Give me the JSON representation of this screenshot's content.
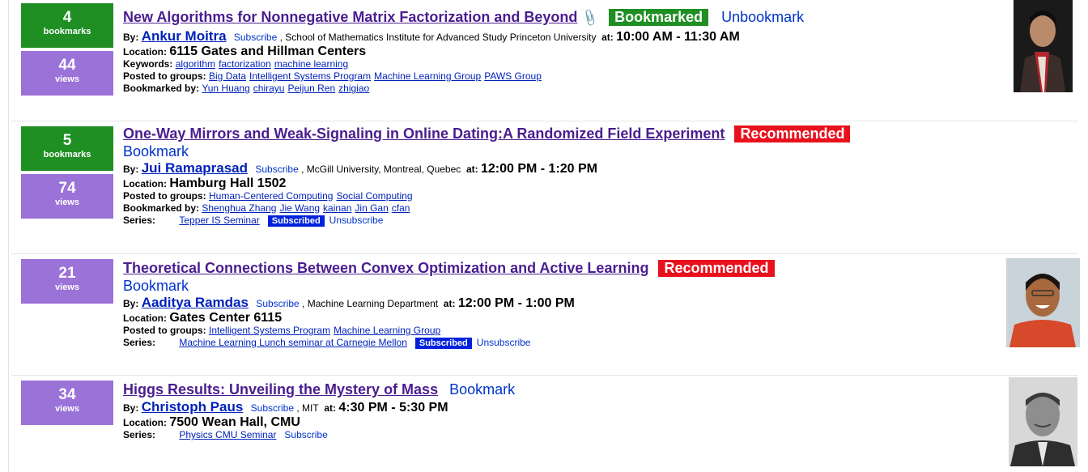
{
  "talks": [
    {
      "bookmarks": "4",
      "bookmarks_label": "bookmarks",
      "views": "44",
      "views_label": "views",
      "title": "New Algorithms for Nonnegative Matrix Factorization and Beyond",
      "status_badge": "Bookmarked",
      "action": "Unbookmark",
      "by_label": "By:",
      "speaker": "Ankur Moitra",
      "subscribe": "Subscribe",
      "affiliation": ", School of Mathematics Institute for Advanced Study Princeton University",
      "at_label": "at:",
      "time": "10:00 AM - 11:30 AM",
      "location_label": "Location:",
      "location": "6115 Gates and Hillman Centers",
      "keywords_label": "Keywords:",
      "keywords": [
        "algorithm",
        "factorization",
        "machine learning"
      ],
      "groups_label": "Posted to groups:",
      "groups": [
        "Big Data",
        "Intelligent Systems Program",
        "Machine Learning Group",
        "PAWS Group"
      ],
      "bookmarked_by_label": "Bookmarked by:",
      "bookmarked_by": [
        "Yun Huang",
        "chirayu",
        "Peijun Ren",
        "zhigiao"
      ]
    },
    {
      "bookmarks": "5",
      "bookmarks_label": "bookmarks",
      "views": "74",
      "views_label": "views",
      "title": "One-Way Mirrors and Weak-Signaling in Online Dating:A Randomized Field Experiment",
      "status_badge": "Recommended",
      "action": "Bookmark",
      "by_label": "By:",
      "speaker": "Jui Ramaprasad",
      "subscribe": "Subscribe",
      "affiliation": ", McGill University, Montreal, Quebec",
      "at_label": "at:",
      "time": "12:00 PM - 1:20 PM",
      "location_label": "Location:",
      "location": "Hamburg Hall 1502",
      "groups_label": "Posted to groups:",
      "groups": [
        "Human-Centered Computing",
        "Social Computing"
      ],
      "bookmarked_by_label": "Bookmarked by:",
      "bookmarked_by": [
        "Shenghua Zhang",
        "Jie Wang",
        "kainan",
        "Jin Gan",
        "cfan"
      ],
      "series_label": "Series:",
      "series": "Tepper IS Seminar",
      "series_status": "Subscribed",
      "series_action": "Unsubscribe"
    },
    {
      "views": "21",
      "views_label": "views",
      "title": "Theoretical Connections Between Convex Optimization and Active Learning",
      "status_badge": "Recommended",
      "action": "Bookmark",
      "by_label": "By:",
      "speaker": "Aaditya Ramdas",
      "subscribe": "Subscribe",
      "affiliation": ", Machine Learning Department",
      "at_label": "at:",
      "time": "12:00 PM - 1:00 PM",
      "location_label": "Location:",
      "location": "Gates Center 6115",
      "groups_label": "Posted to groups:",
      "groups": [
        "Intelligent Systems Program",
        "Machine Learning Group"
      ],
      "series_label": "Series:",
      "series": "Machine Learning Lunch seminar at Carnegie Mellon",
      "series_status": "Subscribed",
      "series_action": "Unsubscribe"
    },
    {
      "views": "34",
      "views_label": "views",
      "title": "Higgs Results: Unveiling the Mystery of Mass",
      "action": "Bookmark",
      "by_label": "By:",
      "speaker": "Christoph Paus",
      "subscribe": "Subscribe",
      "affiliation": ", MIT",
      "at_label": "at:",
      "time": "4:30 PM - 5:30 PM",
      "location_label": "Location:",
      "location": "7500 Wean Hall, CMU",
      "series_label": "Series:",
      "series": "Physics CMU Seminar",
      "series_action": "Subscribe"
    }
  ]
}
